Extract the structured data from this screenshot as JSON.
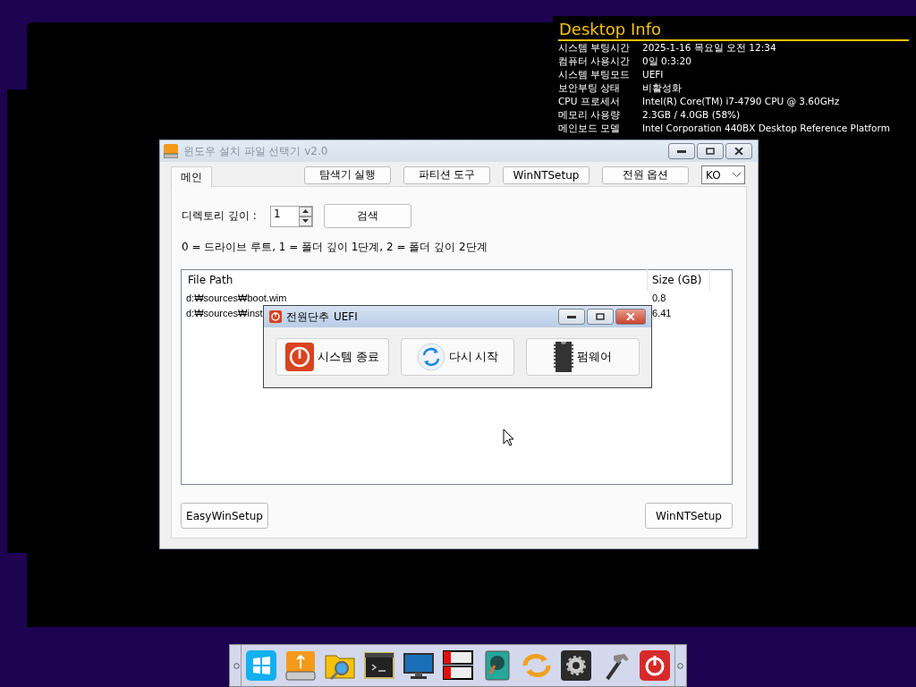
{
  "desktop_info": {
    "title": "Desktop Info",
    "rows": [
      {
        "label": "시스템 부팅시간",
        "value": "2025-1-16 목요일 오전 12:34"
      },
      {
        "label": "컴퓨터 사용시간",
        "value": "0일 0:3:20"
      },
      {
        "label": "시스템 부팅모드",
        "value": "UEFI"
      },
      {
        "label": "보안부팅 상태",
        "value": "비활성화"
      },
      {
        "label": "CPU 프로세서",
        "value": "Intel(R) Core(TM) i7-4790 CPU @ 3.60GHz"
      },
      {
        "label": "메모리 사용량",
        "value": "2.3GB / 4.0GB (58%)"
      },
      {
        "label": "메인보드 모델",
        "value": "Intel Corporation 440BX Desktop Reference Platform"
      }
    ]
  },
  "main_window": {
    "title": "윈도우 설치 파일 선택기 v2.0",
    "tabs": [
      {
        "label": "메인",
        "selected": true
      }
    ],
    "toolbar_buttons": [
      "탐색기 실행",
      "파티션 도구",
      "WinNTSetup",
      "전원 옵션"
    ],
    "language": "KO",
    "depth_label": "디렉토리 깊이 :",
    "depth_value": "1",
    "search_button": "검색",
    "help_text": "0 = 드라이브 루트, 1 = 폴더 깊이 1단계, 2 = 폴더 깊이 2단계",
    "table": {
      "columns": [
        "File Path",
        "Size (GB)"
      ],
      "rows": [
        [
          "d:₩sources₩boot.wim",
          "0.8"
        ],
        [
          "d:₩sources₩inst",
          "6.41"
        ]
      ]
    },
    "bottom_buttons": [
      "EasyWinSetup",
      "WinNTSetup"
    ]
  },
  "power_dialog": {
    "title": "전원단추",
    "mode": "UEFI",
    "buttons": [
      {
        "label": "시스템 종료",
        "kind": "shutdown"
      },
      {
        "label": "다시 시작",
        "kind": "restart"
      },
      {
        "label": "펌웨어",
        "kind": "firmware"
      }
    ]
  }
}
